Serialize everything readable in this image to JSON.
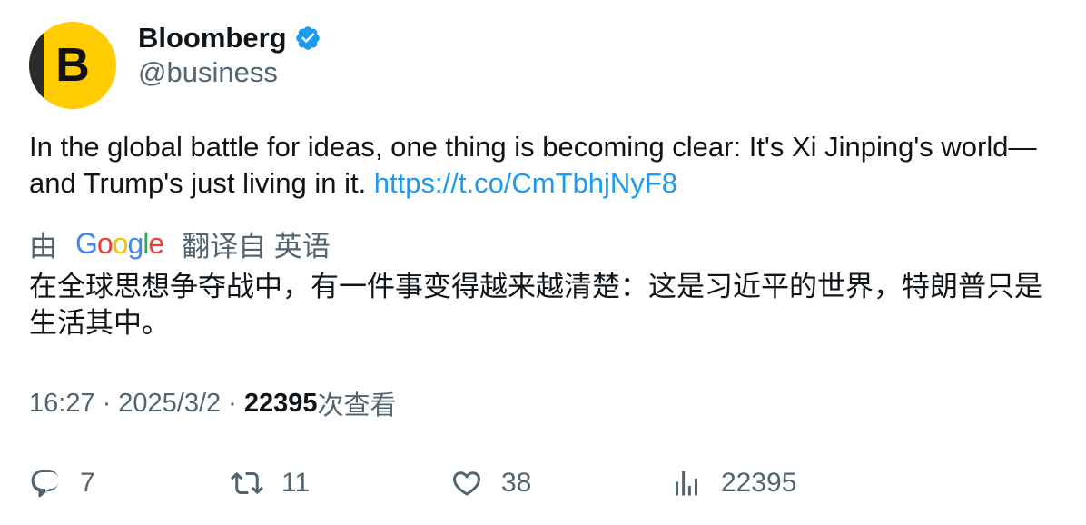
{
  "author": {
    "avatar_letter": "B",
    "name": "Bloomberg",
    "handle": "@business",
    "verified_icon": "verified-badge-icon",
    "brand_color": "#ffcc00",
    "verified_color": "#1d9bf0"
  },
  "tweet": {
    "text": "In the global battle for ideas, one thing is becoming clear: It's Xi Jinping's world—and Trump's just living in it. ",
    "link": "https://t.co/CmTbhjNyF8",
    "link_color": "#1d9bf0"
  },
  "translation": {
    "prefix": "由",
    "provider": "Google",
    "suffix": "翻译自 英语",
    "text": "在全球思想争夺战中，有一件事变得越来越清楚：这是习近平的世界，特朗普只是生活其中。"
  },
  "meta": {
    "time": "16:27",
    "separator": "·",
    "date": "2025/3/2",
    "views_count": "22395",
    "views_label": "次查看"
  },
  "actions": {
    "reply": {
      "icon": "reply-icon",
      "count": "7"
    },
    "retweet": {
      "icon": "retweet-icon",
      "count": "11"
    },
    "like": {
      "icon": "heart-icon",
      "count": "38"
    },
    "views": {
      "icon": "analytics-icon",
      "count": "22395"
    }
  }
}
